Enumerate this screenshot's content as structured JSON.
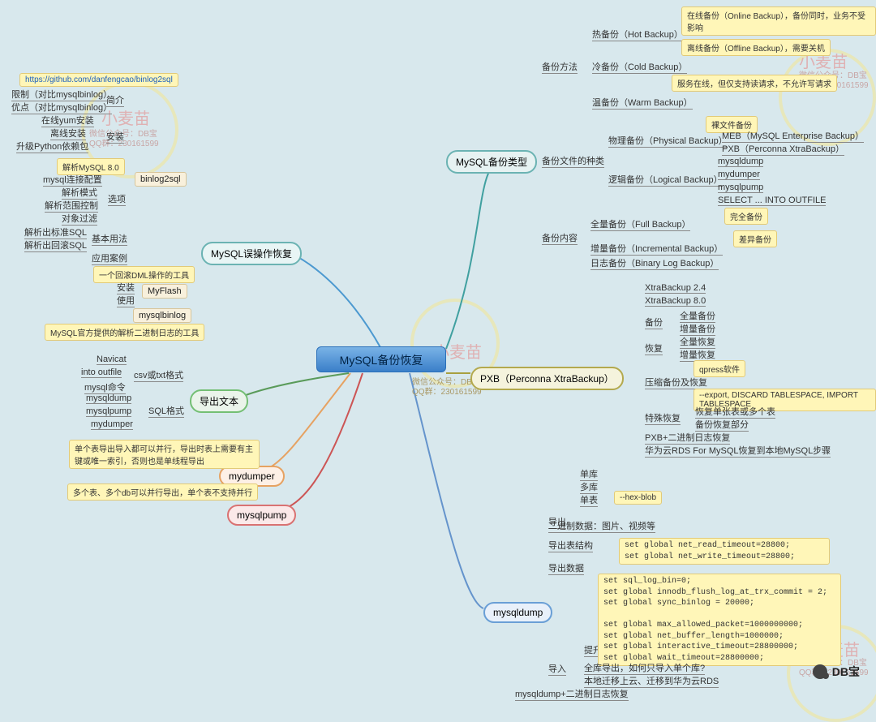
{
  "root": "MySQL备份恢复",
  "root_sub1": "微信公众号：DB宝",
  "root_sub2": "QQ群：230161599",
  "b_types": "MySQL备份类型",
  "b_misop": "MySQL误操作恢复",
  "b_export": "导出文本",
  "b_mydumper": "mydumper",
  "b_mysqlpump": "mysqlpump",
  "b_pxb": "PXB（Perconna XtraBackup）",
  "b_mysqldump": "mysqldump",
  "types": {
    "method": "备份方法",
    "hot": "热备份（Hot Backup）",
    "cold": "冷备份（Cold Backup）",
    "warm": "温备份（Warm Backup）",
    "hot_note": "在线备份（Online Backup），备份同时，业务不受影响",
    "cold_note": "离线备份（Offline Backup），需要关机",
    "warm_note": "服务在线，但仅支持读请求，不允许写请求",
    "filekind": "备份文件的种类",
    "phys": "物理备份（Physical Backup）",
    "phys_note": "裸文件备份",
    "meb": "MEB（MySQL Enterprise Backup）",
    "pxb_note": "PXB（Perconna XtraBackup）",
    "logical": "逻辑备份（Logical Backup）",
    "l_items": [
      "mysqldump",
      "mydumper",
      "mysqlpump",
      "SELECT ... INTO OUTFILE"
    ],
    "fullonly": "完全备份",
    "content": "备份内容",
    "full": "全量备份（Full Backup）",
    "inc": "增量备份（Incremental Backup）",
    "inc_note": "差异备份",
    "binlog": "日志备份（Binary Log Backup）"
  },
  "misop": {
    "binlog2sql": "binlog2sql",
    "url": "https://github.com/danfengcao/binlog2sql",
    "intro": "简介",
    "intro_items": [
      "限制（对比mysqlbinlog）",
      "优点（对比mysqlbinlog）"
    ],
    "install": "安装",
    "install_items": [
      "在线yum安装",
      "离线安装",
      "升级Python依赖包",
      "解析MySQL 8.0"
    ],
    "options": "选项",
    "opt_items": [
      "mysql连接配置",
      "解析模式",
      "解析范围控制",
      "对象过滤"
    ],
    "basic": "基本用法",
    "basic_items": [
      "解析出标准SQL",
      "解析出回滚SQL"
    ],
    "cases": "应用案例",
    "myflash": "MyFlash",
    "myflash_note": "一个回滚DML操作的工具",
    "myflash_items": [
      "安装",
      "使用"
    ],
    "mysqlbinlog": "mysqlbinlog",
    "mysqlbinlog_note": "MySQL官方提供的解析二进制日志的工具"
  },
  "export": {
    "csv": "csv或txt格式",
    "csv_items": [
      "Navicat",
      "into outfile",
      "mysql命令"
    ],
    "sql": "SQL格式",
    "sql_items": [
      "mysqldump",
      "mysqlpump",
      "mydumper"
    ]
  },
  "mydumper_note": "单个表导出导入都可以并行，导出时表上需要有主键或唯一索引，否则也是单线程导出",
  "mysqlpump_note": "多个表、多个db可以并行导出，单个表不支持并行",
  "pxb": {
    "v24": "XtraBackup 2.4",
    "v80": "XtraBackup 8.0",
    "backup": "备份",
    "b_items": [
      "全量备份",
      "增量备份"
    ],
    "restore": "恢复",
    "r_items": [
      "全量恢复",
      "增量恢复"
    ],
    "qpress": "qpress软件",
    "compress": "压缩备份及恢复",
    "special": "特殊恢复",
    "special_note": "--export, DISCARD TABLESPACE, IMPORT TABLESPACE",
    "s_items": [
      "恢复单张表或多个表",
      "备份恢复部分"
    ],
    "pxb_binlog": "PXB+二进制日志恢复",
    "huawei": "华为云RDS For MySQL恢复到本地MySQL步骤"
  },
  "dump": {
    "export": "导出",
    "e_items": [
      "单库",
      "多库",
      "单表"
    ],
    "hex": "--hex-blob",
    "bin": "二进制数据：图片、视频等",
    "struct": "导出表结构",
    "data": "导出数据",
    "data_note": "set global net_read_timeout=28800;\nset global net_write_timeout=28800;",
    "import": "导入",
    "speed": "提升速度",
    "speed_code": "set sql_log_bin=0;\nset global innodb_flush_log_at_trx_commit = 2;\nset global sync_binlog = 20000;\n\nset global max_allowed_packet=1000000000;\nset global net_buffer_length=1000000;\nset global interactive_timeout=28800000;\nset global wait_timeout=28800000;",
    "i_items": [
      "全库导出，如何只导入单个库?",
      "本地迁移上云、迁移到华为云RDS"
    ],
    "combo": "mysqldump+二进制日志恢复"
  },
  "wm": "小麦苗",
  "wm_sub1": "微信公众号：DB宝",
  "wm_sub2": "QQ群：230161599",
  "logo_text": "DB宝"
}
